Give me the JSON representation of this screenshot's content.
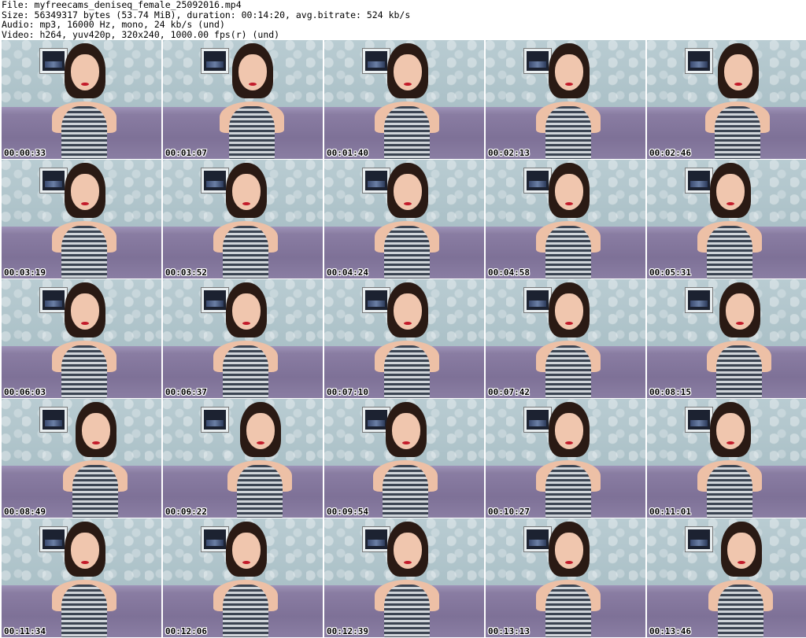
{
  "header": {
    "file": "File: myfreecams_deniseq_female_25092016.mp4",
    "size": "Size: 56349317 bytes (53.74 MiB), duration: 00:14:20, avg.bitrate: 524 kb/s",
    "audio": "Audio: mp3, 16000 Hz, mono, 24 kb/s (und)",
    "video": "Video: h264, yuv420p, 320x240, 1000.00 fps(r) (und)"
  },
  "thumbnails": [
    {
      "time": "00:00:33"
    },
    {
      "time": "00:01:07"
    },
    {
      "time": "00:01:40"
    },
    {
      "time": "00:02:13"
    },
    {
      "time": "00:02:46"
    },
    {
      "time": "00:03:19"
    },
    {
      "time": "00:03:52"
    },
    {
      "time": "00:04:24"
    },
    {
      "time": "00:04:58"
    },
    {
      "time": "00:05:31"
    },
    {
      "time": "00:06:03"
    },
    {
      "time": "00:06:37"
    },
    {
      "time": "00:07:10"
    },
    {
      "time": "00:07:42"
    },
    {
      "time": "00:08:15"
    },
    {
      "time": "00:08:49"
    },
    {
      "time": "00:09:22"
    },
    {
      "time": "00:09:54"
    },
    {
      "time": "00:10:27"
    },
    {
      "time": "00:11:01"
    },
    {
      "time": "00:11:34"
    },
    {
      "time": "00:12:06"
    },
    {
      "time": "00:12:39"
    },
    {
      "time": "00:13:13"
    },
    {
      "time": "00:13:46"
    }
  ]
}
